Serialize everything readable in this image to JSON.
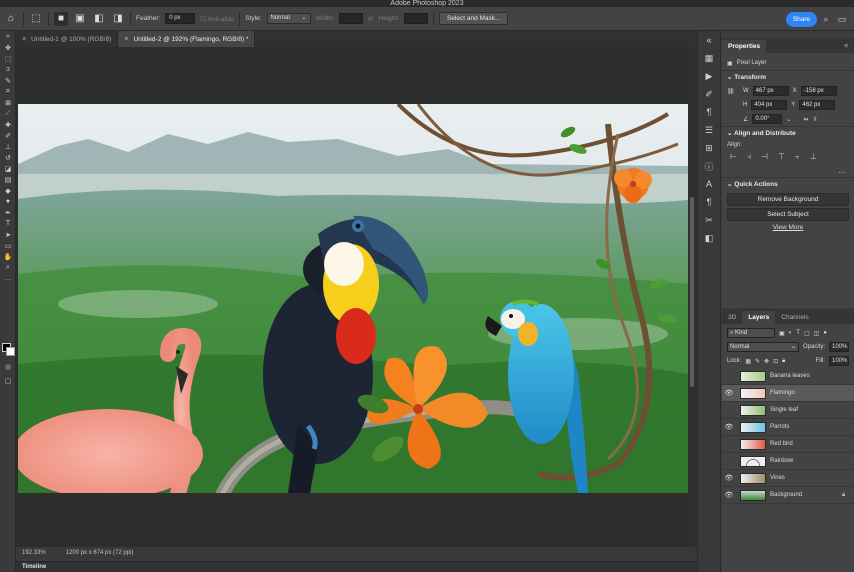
{
  "app": {
    "title": "Adobe Photoshop 2023"
  },
  "options": {
    "feather_label": "Feather:",
    "feather_value": "0 px",
    "antialias_label": "Anti-alias",
    "style_label": "Style:",
    "style_value": "Normal",
    "width_label": "Width:",
    "height_label": "Height:",
    "select_mask_label": "Select and Mask...",
    "share_label": "Share"
  },
  "tabs": [
    {
      "label": "Untitled-1 @ 100% (RGB/8)"
    },
    {
      "label": "Untitled-2 @ 192% (Flamingo, RGB/8) *"
    }
  ],
  "status": {
    "zoom": "192.33%",
    "doc_size": "1200 px x 674 px (72 ppi)"
  },
  "timeline_label": "Timeline",
  "properties": {
    "tab_label": "Properties",
    "layer_type": "Pixel Layer",
    "transform_label": "Transform",
    "w_label": "W",
    "w_value": "467 px",
    "h_label": "H",
    "h_value": "404 px",
    "x_label": "X",
    "x_value": "-158 px",
    "y_label": "Y",
    "y_value": "462 px",
    "angle_value": "0.00°",
    "align_label": "Align and Distribute",
    "align_sub": "Align:",
    "quick_actions_label": "Quick Actions",
    "remove_bg_label": "Remove Background",
    "select_subject_label": "Select Subject",
    "view_more_label": "View More"
  },
  "layers_panel": {
    "tabs": [
      "3D",
      "Layers",
      "Channels"
    ],
    "kind_label": "Kind",
    "blend_mode": "Normal",
    "opacity_label": "Opacity:",
    "opacity_value": "100%",
    "lock_label": "Lock:",
    "fill_label": "Fill:",
    "fill_value": "100%",
    "layers": [
      {
        "name": "Banana leaves",
        "visible": false,
        "selected": false,
        "locked": false
      },
      {
        "name": "Flamingo",
        "visible": true,
        "selected": true,
        "locked": false
      },
      {
        "name": "Single leaf",
        "visible": false,
        "selected": false,
        "locked": false
      },
      {
        "name": "Parrots",
        "visible": true,
        "selected": false,
        "locked": false
      },
      {
        "name": "Red bird",
        "visible": false,
        "selected": false,
        "locked": false
      },
      {
        "name": "Rainbow",
        "visible": false,
        "selected": false,
        "locked": false
      },
      {
        "name": "Vines",
        "visible": true,
        "selected": false,
        "locked": false
      },
      {
        "name": "Background",
        "visible": true,
        "selected": false,
        "locked": true
      }
    ]
  },
  "colors": {
    "accent": "#2e86f6",
    "panel": "#434343",
    "canvas_bg": "#2d2d2d"
  }
}
